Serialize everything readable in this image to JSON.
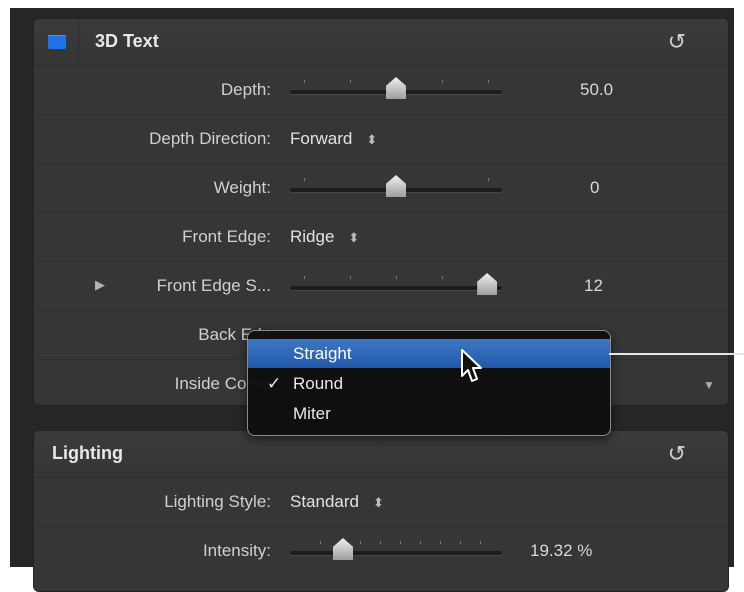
{
  "text_panel": {
    "title": "3D Text",
    "reset_glyph": "↺",
    "rows": [
      {
        "label": "Depth:",
        "type": "slider",
        "value": "50.0",
        "fraction": 0.5
      },
      {
        "label": "Depth Direction:",
        "type": "popup",
        "value": "Forward"
      },
      {
        "label": "Weight:",
        "type": "slider",
        "value": "0",
        "fraction": 0.5
      },
      {
        "label": "Front Edge:",
        "type": "popup",
        "value": "Ridge"
      },
      {
        "label": "Front Edge S...",
        "type": "slider",
        "value": "12",
        "fraction": 0.93
      },
      {
        "label": "Back Edg",
        "type": "popup",
        "value": ""
      },
      {
        "label": "Inside Corne",
        "type": "popup",
        "value": ""
      }
    ]
  },
  "lighting_panel": {
    "title": "Lighting",
    "rows": [
      {
        "label": "Lighting Style:",
        "type": "popup",
        "value": "Standard"
      },
      {
        "label": "Intensity:",
        "type": "slider",
        "value": "19.32 %",
        "fraction": 0.25
      }
    ]
  },
  "menu": {
    "items": [
      "Straight",
      "Round",
      "Miter"
    ],
    "highlighted": "Straight",
    "checked": "Round",
    "check_glyph": "✓"
  },
  "glyphs": {
    "updown": "⬍",
    "disclosure": "▶",
    "popup_arrow": "▼"
  }
}
